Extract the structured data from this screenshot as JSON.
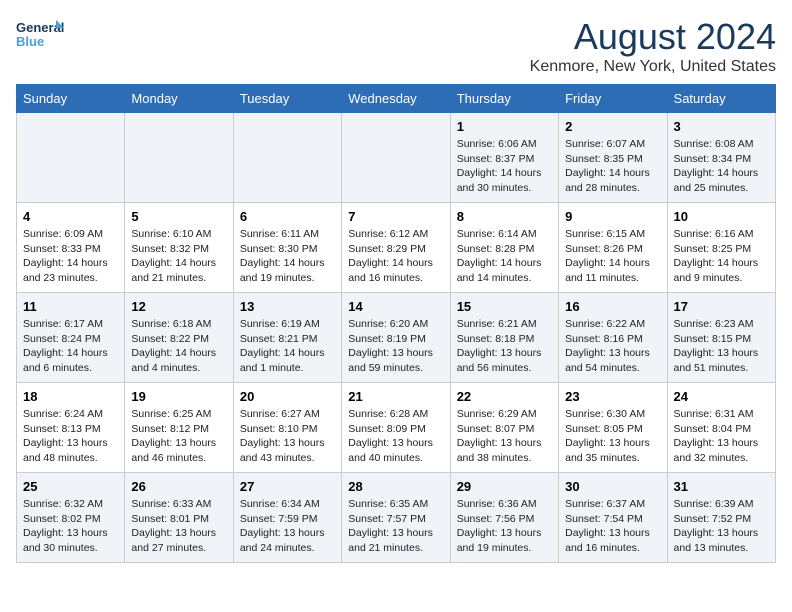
{
  "header": {
    "logo_line1": "General",
    "logo_line2": "Blue",
    "title": "August 2024",
    "subtitle": "Kenmore, New York, United States"
  },
  "days_of_week": [
    "Sunday",
    "Monday",
    "Tuesday",
    "Wednesday",
    "Thursday",
    "Friday",
    "Saturday"
  ],
  "weeks": [
    [
      {
        "day": "",
        "text": ""
      },
      {
        "day": "",
        "text": ""
      },
      {
        "day": "",
        "text": ""
      },
      {
        "day": "",
        "text": ""
      },
      {
        "day": "1",
        "text": "Sunrise: 6:06 AM\nSunset: 8:37 PM\nDaylight: 14 hours\nand 30 minutes."
      },
      {
        "day": "2",
        "text": "Sunrise: 6:07 AM\nSunset: 8:35 PM\nDaylight: 14 hours\nand 28 minutes."
      },
      {
        "day": "3",
        "text": "Sunrise: 6:08 AM\nSunset: 8:34 PM\nDaylight: 14 hours\nand 25 minutes."
      }
    ],
    [
      {
        "day": "4",
        "text": "Sunrise: 6:09 AM\nSunset: 8:33 PM\nDaylight: 14 hours\nand 23 minutes."
      },
      {
        "day": "5",
        "text": "Sunrise: 6:10 AM\nSunset: 8:32 PM\nDaylight: 14 hours\nand 21 minutes."
      },
      {
        "day": "6",
        "text": "Sunrise: 6:11 AM\nSunset: 8:30 PM\nDaylight: 14 hours\nand 19 minutes."
      },
      {
        "day": "7",
        "text": "Sunrise: 6:12 AM\nSunset: 8:29 PM\nDaylight: 14 hours\nand 16 minutes."
      },
      {
        "day": "8",
        "text": "Sunrise: 6:14 AM\nSunset: 8:28 PM\nDaylight: 14 hours\nand 14 minutes."
      },
      {
        "day": "9",
        "text": "Sunrise: 6:15 AM\nSunset: 8:26 PM\nDaylight: 14 hours\nand 11 minutes."
      },
      {
        "day": "10",
        "text": "Sunrise: 6:16 AM\nSunset: 8:25 PM\nDaylight: 14 hours\nand 9 minutes."
      }
    ],
    [
      {
        "day": "11",
        "text": "Sunrise: 6:17 AM\nSunset: 8:24 PM\nDaylight: 14 hours\nand 6 minutes."
      },
      {
        "day": "12",
        "text": "Sunrise: 6:18 AM\nSunset: 8:22 PM\nDaylight: 14 hours\nand 4 minutes."
      },
      {
        "day": "13",
        "text": "Sunrise: 6:19 AM\nSunset: 8:21 PM\nDaylight: 14 hours\nand 1 minute."
      },
      {
        "day": "14",
        "text": "Sunrise: 6:20 AM\nSunset: 8:19 PM\nDaylight: 13 hours\nand 59 minutes."
      },
      {
        "day": "15",
        "text": "Sunrise: 6:21 AM\nSunset: 8:18 PM\nDaylight: 13 hours\nand 56 minutes."
      },
      {
        "day": "16",
        "text": "Sunrise: 6:22 AM\nSunset: 8:16 PM\nDaylight: 13 hours\nand 54 minutes."
      },
      {
        "day": "17",
        "text": "Sunrise: 6:23 AM\nSunset: 8:15 PM\nDaylight: 13 hours\nand 51 minutes."
      }
    ],
    [
      {
        "day": "18",
        "text": "Sunrise: 6:24 AM\nSunset: 8:13 PM\nDaylight: 13 hours\nand 48 minutes."
      },
      {
        "day": "19",
        "text": "Sunrise: 6:25 AM\nSunset: 8:12 PM\nDaylight: 13 hours\nand 46 minutes."
      },
      {
        "day": "20",
        "text": "Sunrise: 6:27 AM\nSunset: 8:10 PM\nDaylight: 13 hours\nand 43 minutes."
      },
      {
        "day": "21",
        "text": "Sunrise: 6:28 AM\nSunset: 8:09 PM\nDaylight: 13 hours\nand 40 minutes."
      },
      {
        "day": "22",
        "text": "Sunrise: 6:29 AM\nSunset: 8:07 PM\nDaylight: 13 hours\nand 38 minutes."
      },
      {
        "day": "23",
        "text": "Sunrise: 6:30 AM\nSunset: 8:05 PM\nDaylight: 13 hours\nand 35 minutes."
      },
      {
        "day": "24",
        "text": "Sunrise: 6:31 AM\nSunset: 8:04 PM\nDaylight: 13 hours\nand 32 minutes."
      }
    ],
    [
      {
        "day": "25",
        "text": "Sunrise: 6:32 AM\nSunset: 8:02 PM\nDaylight: 13 hours\nand 30 minutes."
      },
      {
        "day": "26",
        "text": "Sunrise: 6:33 AM\nSunset: 8:01 PM\nDaylight: 13 hours\nand 27 minutes."
      },
      {
        "day": "27",
        "text": "Sunrise: 6:34 AM\nSunset: 7:59 PM\nDaylight: 13 hours\nand 24 minutes."
      },
      {
        "day": "28",
        "text": "Sunrise: 6:35 AM\nSunset: 7:57 PM\nDaylight: 13 hours\nand 21 minutes."
      },
      {
        "day": "29",
        "text": "Sunrise: 6:36 AM\nSunset: 7:56 PM\nDaylight: 13 hours\nand 19 minutes."
      },
      {
        "day": "30",
        "text": "Sunrise: 6:37 AM\nSunset: 7:54 PM\nDaylight: 13 hours\nand 16 minutes."
      },
      {
        "day": "31",
        "text": "Sunrise: 6:39 AM\nSunset: 7:52 PM\nDaylight: 13 hours\nand 13 minutes."
      }
    ]
  ]
}
